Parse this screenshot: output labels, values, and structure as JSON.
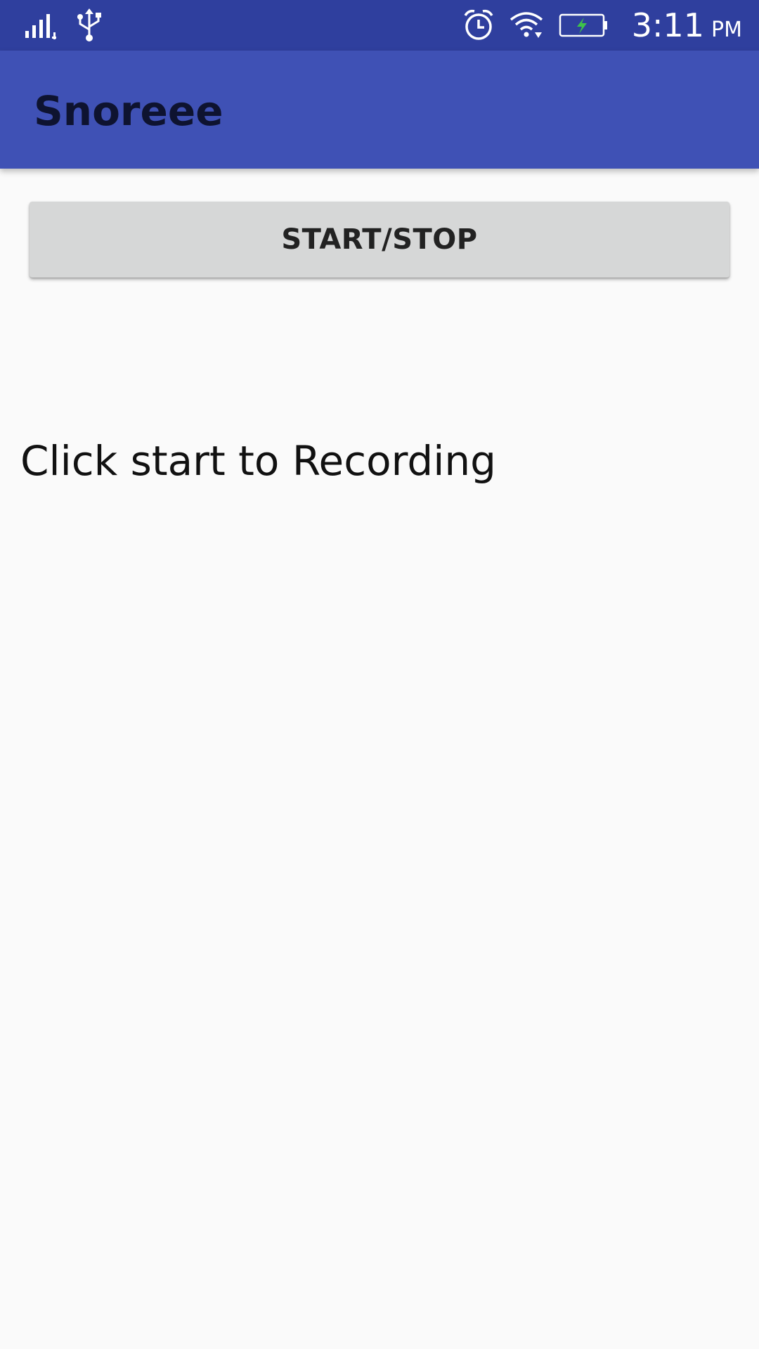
{
  "status_bar": {
    "time": "3:11",
    "ampm": "PM",
    "icons": [
      "signal-icon",
      "usb-icon",
      "alarm-icon",
      "wifi-icon",
      "battery-charging-icon"
    ],
    "battery_bolt_color": "#3ec24a"
  },
  "app_bar": {
    "title": "Snoreee",
    "color": "#3f51b5"
  },
  "main": {
    "start_stop_label": "START/STOP",
    "status_text": "Click start to Recording"
  }
}
